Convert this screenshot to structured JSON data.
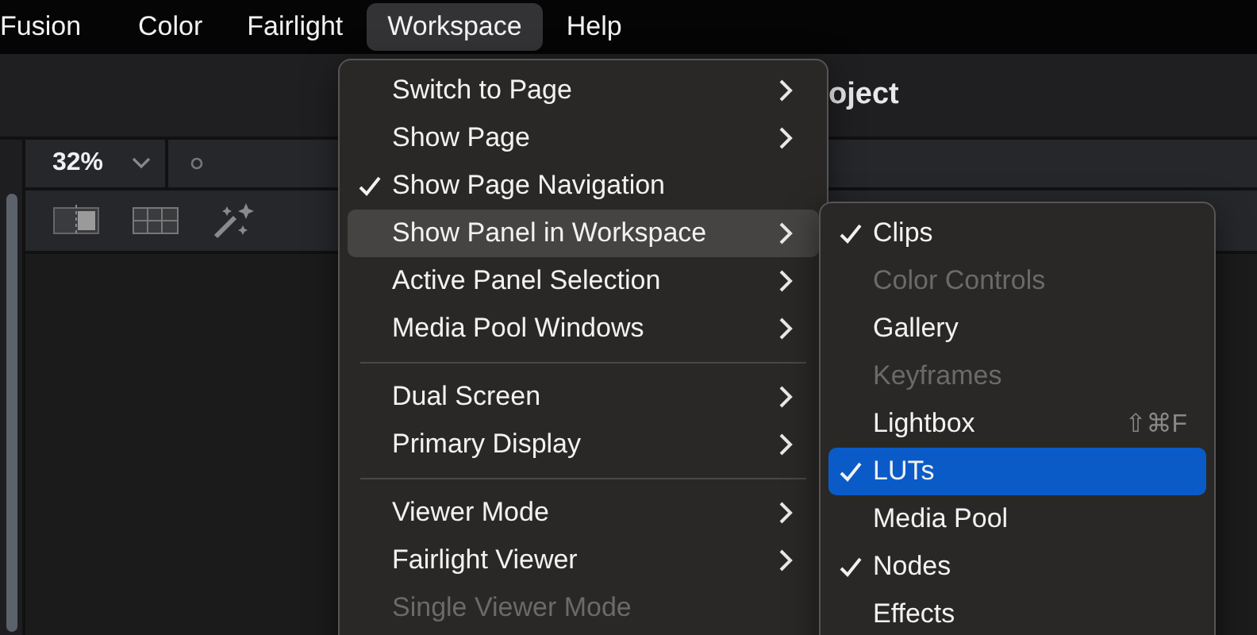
{
  "menubar": [
    {
      "label": "Fusion",
      "selected": false
    },
    {
      "label": "Color",
      "selected": false
    },
    {
      "label": "Fairlight",
      "selected": false
    },
    {
      "label": "Workspace",
      "selected": true
    },
    {
      "label": "Help",
      "selected": false
    }
  ],
  "app": {
    "title": "oject",
    "zoom": "32%"
  },
  "menu": [
    {
      "kind": "item",
      "label": "Switch to Page",
      "submenu": true,
      "checked": false,
      "disabled": false,
      "selected": false
    },
    {
      "kind": "item",
      "label": "Show Page",
      "submenu": true,
      "checked": false,
      "disabled": false,
      "selected": false
    },
    {
      "kind": "item",
      "label": "Show Page Navigation",
      "submenu": false,
      "checked": true,
      "disabled": false,
      "selected": false
    },
    {
      "kind": "item",
      "label": "Show Panel in Workspace",
      "submenu": true,
      "checked": false,
      "disabled": false,
      "selected": true
    },
    {
      "kind": "item",
      "label": "Active Panel Selection",
      "submenu": true,
      "checked": false,
      "disabled": false,
      "selected": false
    },
    {
      "kind": "item",
      "label": "Media Pool Windows",
      "submenu": true,
      "checked": false,
      "disabled": false,
      "selected": false
    },
    {
      "kind": "separator"
    },
    {
      "kind": "item",
      "label": "Dual Screen",
      "submenu": true,
      "checked": false,
      "disabled": false,
      "selected": false
    },
    {
      "kind": "item",
      "label": "Primary Display",
      "submenu": true,
      "checked": false,
      "disabled": false,
      "selected": false
    },
    {
      "kind": "separator"
    },
    {
      "kind": "item",
      "label": "Viewer Mode",
      "submenu": true,
      "checked": false,
      "disabled": false,
      "selected": false
    },
    {
      "kind": "item",
      "label": "Fairlight Viewer",
      "submenu": true,
      "checked": false,
      "disabled": false,
      "selected": false
    },
    {
      "kind": "item",
      "label": "Single Viewer Mode",
      "submenu": false,
      "checked": false,
      "disabled": true,
      "selected": false
    }
  ],
  "submenu": [
    {
      "label": "Clips",
      "checked": true,
      "disabled": false,
      "selected": false
    },
    {
      "label": "Color Controls",
      "checked": false,
      "disabled": true,
      "selected": false
    },
    {
      "label": "Gallery",
      "checked": false,
      "disabled": false,
      "selected": false
    },
    {
      "label": "Keyframes",
      "checked": false,
      "disabled": true,
      "selected": false
    },
    {
      "label": "Lightbox",
      "checked": false,
      "disabled": false,
      "selected": false,
      "shortcut": "⇧⌘F"
    },
    {
      "label": "LUTs",
      "checked": true,
      "disabled": false,
      "selected": true
    },
    {
      "label": "Media Pool",
      "checked": false,
      "disabled": false,
      "selected": false
    },
    {
      "label": "Nodes",
      "checked": true,
      "disabled": false,
      "selected": false
    },
    {
      "label": "Effects",
      "checked": false,
      "disabled": false,
      "selected": false
    }
  ]
}
